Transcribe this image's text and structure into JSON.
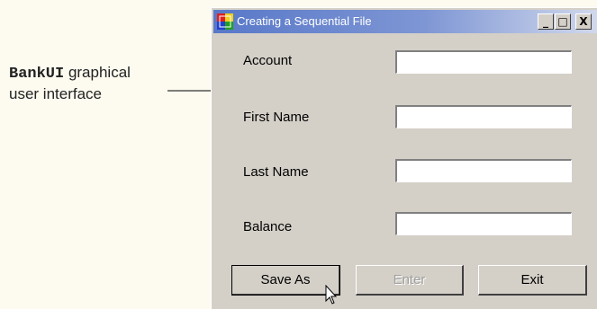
{
  "annotation": {
    "code": "BankUI",
    "line1_rest": " graphical",
    "line2": "user interface"
  },
  "window": {
    "title": "Creating a Sequential File",
    "controls": {
      "minimize": "_",
      "maximize": "□",
      "close": "X"
    }
  },
  "fields": [
    {
      "label": "Account",
      "value": ""
    },
    {
      "label": "First Name",
      "value": ""
    },
    {
      "label": "Last Name",
      "value": ""
    },
    {
      "label": "Balance",
      "value": ""
    }
  ],
  "buttons": {
    "save_as": "Save As",
    "enter": "Enter",
    "exit": "Exit"
  }
}
